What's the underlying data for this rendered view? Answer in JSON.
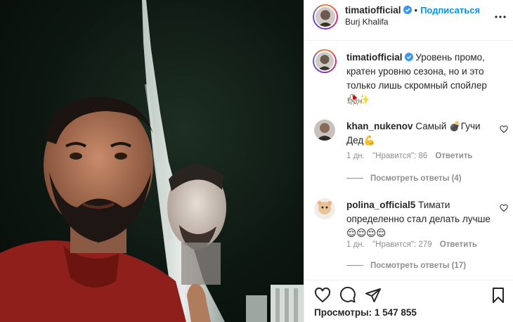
{
  "post": {
    "username": "timatiofficial",
    "follow_label": "Подписаться",
    "location": "Burj Khalifa",
    "separator": "•"
  },
  "caption": {
    "username": "timatiofficial",
    "text": "Уровень промо, кратен уровню сезона, но и это только лишь скромный спойлер 🥀✨",
    "time": "1 дн."
  },
  "comments": [
    {
      "username": "khan_nukenov",
      "text": "Самый 💣Гучи Дед💪",
      "time": "1 дн.",
      "likes": "\"Нравится\": 86",
      "reply_label": "Ответить",
      "view_replies": "Посмотреть ответы (4)"
    },
    {
      "username": "polina_official5",
      "text": "Тимати определенно стал делать лучше 😌😌😌😌",
      "time": "1 дн.",
      "likes": "\"Нравится\": 279",
      "reply_label": "Ответить",
      "view_replies": "Посмотреть ответы (17)"
    }
  ],
  "footer": {
    "views": "Просмотры: 1 547 855"
  },
  "colors": {
    "accent": "#0095f6",
    "verified": "#3897f0",
    "muted": "#8e8e8e",
    "text": "#262626"
  },
  "icons": [
    "heart-icon",
    "comment-icon",
    "share-icon",
    "bookmark-icon",
    "more-icon",
    "verified-badge-icon"
  ]
}
